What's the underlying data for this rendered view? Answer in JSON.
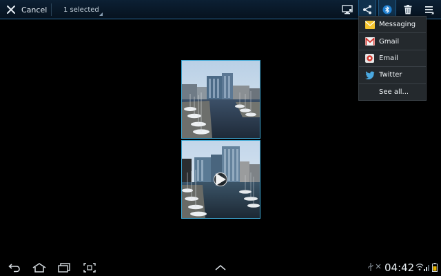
{
  "action_bar": {
    "cancel_label": "Cancel",
    "selection_label": "1 selected",
    "accent_color": "#2c6fa0"
  },
  "share_menu": {
    "items": [
      {
        "label": "Messaging",
        "icon": "envelope-icon"
      },
      {
        "label": "Gmail",
        "icon": "gmail-icon"
      },
      {
        "label": "Email",
        "icon": "email-icon"
      },
      {
        "label": "Twitter",
        "icon": "twitter-bird-icon"
      },
      {
        "label": "See all...",
        "icon": ""
      }
    ]
  },
  "gallery": {
    "items": [
      {
        "type": "photo",
        "selected": true
      },
      {
        "type": "video",
        "selected": false
      }
    ]
  },
  "status_bar": {
    "time": "04:42"
  }
}
